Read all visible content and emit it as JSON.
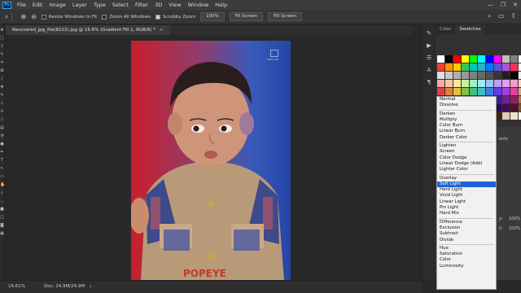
{
  "menubar": {
    "logo": "Ps",
    "items": [
      "File",
      "Edit",
      "Image",
      "Layer",
      "Type",
      "Select",
      "Filter",
      "3D",
      "View",
      "Window",
      "Help"
    ],
    "controls": [
      "—",
      "❐",
      "✕"
    ]
  },
  "options": {
    "resize_windows": "Resize Windows to Fit",
    "zoom_all_windows": "Zoom All Windows",
    "scrubby_zoom": "Scrubby Zoom",
    "zoom_percent": "100%",
    "fit_screen": "Fit Screen",
    "fill_screen": "Fill Screen"
  },
  "document": {
    "tab_title": "Recovered_jpg_file(8222).jpg @ 16.6% (Gradient Fill 1, RGB/8) *",
    "close": "×",
    "watermark": "VISIT SR"
  },
  "panel": {
    "tabs": [
      "Color",
      "Swatches"
    ],
    "active_tab": "Swatches",
    "layer_labels": [
      "ents",
      "y:",
      "ll:"
    ],
    "layer_values": [
      "100%",
      "100%"
    ]
  },
  "blend_modes": [
    [
      "Normal",
      "Dissolve"
    ],
    [
      "Darken",
      "Multiply",
      "Color Burn",
      "Linear Burn",
      "Darker Color"
    ],
    [
      "Lighten",
      "Screen",
      "Color Dodge",
      "Linear Dodge (Add)",
      "Lighter Color"
    ],
    [
      "Overlay",
      "Soft Light",
      "Hard Light",
      "Vivid Light",
      "Linear Light",
      "Pin Light",
      "Hard Mix"
    ],
    [
      "Difference",
      "Exclusion",
      "Subtract",
      "Divide"
    ],
    [
      "Hue",
      "Saturation",
      "Color",
      "Luminosity"
    ]
  ],
  "blend_selected": "Soft Light",
  "status": {
    "zoom": "16.61%",
    "doc": "Doc: 24.9M/24.9M",
    "arrow": "›"
  },
  "colors": {
    "accent": "#31a8ff",
    "selected": "#1e62d6",
    "gradient_left": "#c81f2c",
    "gradient_right": "#2446a8"
  }
}
